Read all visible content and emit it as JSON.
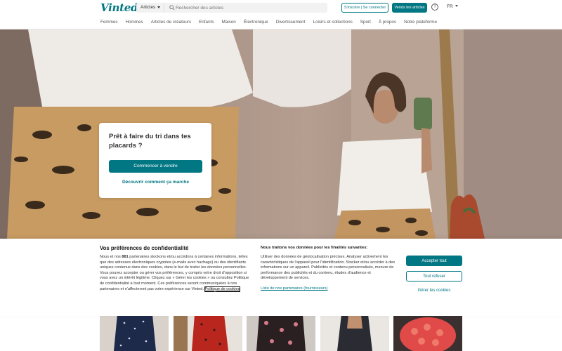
{
  "header": {
    "logo": "Vinted",
    "search": {
      "category": "Articles",
      "placeholder": "Rechercher des articles"
    },
    "login_label": "S'inscrire | Se connecter",
    "sell_label": "Vends tes articles",
    "help_glyph": "?",
    "language": "FR"
  },
  "nav": [
    "Femmes",
    "Hommes",
    "Articles de créateurs",
    "Enfants",
    "Maison",
    "Électronique",
    "Divertissement",
    "Loisirs et collections",
    "Sport",
    "À propos",
    "Notre plateforme"
  ],
  "hero": {
    "title": "Prêt à faire du tri dans tes placards ?",
    "cta": "Commencer à vendre",
    "link": "Découvrir comment ça marche"
  },
  "cookie_banner": {
    "title": "Vos préférences de confidentialité",
    "text_before_bold": "Nous et nos ",
    "partner_count": "881",
    "text_after_bold": " partenaires stockons et/ou accédons à certaines informations, telles que des adresses électroniques cryptées (e-mails avec hachage) ou des identifiants uniques contenus dans des cookies, dans le but de traiter les données personnelles. Vous pouvez accepter ou gérer vos préférences, y compris votre droit d'opposition si vous avez un intérêt légitime. Cliquez sur « Gérer les cookies » ou consultez Politique de confidentialité à tout moment. Ces préférences seront communiquées à nos partenaires et n'affecteront pas votre expérience sur Vinted. ",
    "policy_link": "Politique de cookies",
    "purposes_title": "Nous traitons vos données pour les finalités suivantes:",
    "purposes_text": "Utiliser des données de géolocalisation précises. Analyser activement les caractéristiques de l'appareil pour l'identification. Stocker et/ou accéder à des informations sur un appareil. Publicités et contenu personnalisés, mesure de performance des publicités et du contenu, études d'audience et développement de services.",
    "partners_link": "Liste de nos partenaires (fournisseurs)",
    "accept_label": "Accepter tout",
    "refuse_label": "Tout refuser",
    "manage_label": "Gérer les cookies"
  },
  "colors": {
    "brand": "#007782",
    "banner_bg": "#ffffff"
  }
}
